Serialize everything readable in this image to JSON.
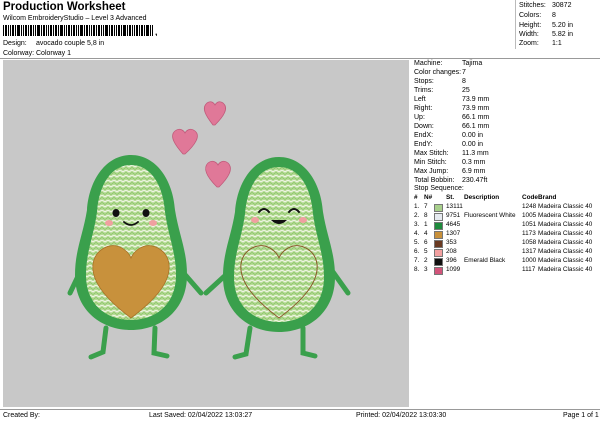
{
  "header": {
    "title": "Production Worksheet",
    "subtitle": "Wilcom EmbroideryStudio – Level 3 Advanced",
    "barcode_char": ","
  },
  "meta": {
    "design_label": "Design:",
    "design_value": "avocado couple 5,8 in",
    "colorway_label": "Colorway:",
    "colorway_value": "Colorway 1"
  },
  "stats": [
    {
      "label": "Stitches:",
      "value": "30872"
    },
    {
      "label": "Colors:",
      "value": "8"
    },
    {
      "label": "Height:",
      "value": "5.20 in"
    },
    {
      "label": "Width:",
      "value": "5.82 in"
    },
    {
      "label": "Zoom:",
      "value": "1:1"
    }
  ],
  "properties": [
    {
      "label": "Machine:",
      "value": "Tajima"
    },
    {
      "label": "Color changes:",
      "value": "7"
    },
    {
      "label": "Stops:",
      "value": "8"
    },
    {
      "label": "Trims:",
      "value": "25"
    },
    {
      "label": "Left",
      "value": "73.9 mm"
    },
    {
      "label": "Right:",
      "value": "73.9 mm"
    },
    {
      "label": "Up:",
      "value": "66.1 mm"
    },
    {
      "label": "Down:",
      "value": "66.1 mm"
    },
    {
      "label": "EndX:",
      "value": "0.00 in"
    },
    {
      "label": "EndY:",
      "value": "0.00 in"
    },
    {
      "label": "Max Stitch:",
      "value": "11.3 mm"
    },
    {
      "label": "Min Stitch:",
      "value": "0.3 mm"
    },
    {
      "label": "Max Jump:",
      "value": "6.9 mm"
    },
    {
      "label": "Total Bobbin:",
      "value": "230.47ft"
    }
  ],
  "stop_sequence": {
    "label": "Stop Sequence:",
    "headers": {
      "hash": "#",
      "n": "N#",
      "st": "St.",
      "desc": "Description",
      "code": "Code",
      "brand": "Brand"
    },
    "rows": [
      {
        "hash": "1.",
        "n": "7",
        "color": "#a8d08c",
        "st": "13111",
        "desc": "",
        "code": "1248",
        "brand": "Madeira Classic 40"
      },
      {
        "hash": "2.",
        "n": "8",
        "color": "#e6eaf0",
        "st": "9751",
        "desc": "Fluorescent White",
        "code": "1005",
        "brand": "Madeira Classic 40"
      },
      {
        "hash": "3.",
        "n": "1",
        "color": "#1e8a3c",
        "st": "4645",
        "desc": "",
        "code": "1051",
        "brand": "Madeira Classic 40"
      },
      {
        "hash": "4.",
        "n": "4",
        "color": "#c8903a",
        "st": "1307",
        "desc": "",
        "code": "1173",
        "brand": "Madeira Classic 40"
      },
      {
        "hash": "5.",
        "n": "6",
        "color": "#6a3a22",
        "st": "353",
        "desc": "",
        "code": "1058",
        "brand": "Madeira Classic 40"
      },
      {
        "hash": "6.",
        "n": "5",
        "color": "#f2a0a0",
        "st": "208",
        "desc": "",
        "code": "1317",
        "brand": "Madeira Classic 40"
      },
      {
        "hash": "7.",
        "n": "2",
        "color": "#101010",
        "st": "396",
        "desc": "Emerald Black",
        "code": "1000",
        "brand": "Madeira Classic 40"
      },
      {
        "hash": "8.",
        "n": "3",
        "color": "#d2547a",
        "st": "1099",
        "desc": "",
        "code": "1117",
        "brand": "Madeira Classic 40"
      }
    ]
  },
  "footer": {
    "created": "Created By:",
    "saved": "Last Saved: 02/04/2022 13:03:27",
    "printed": "Printed: 02/04/2022 13:03:30",
    "page": "Page 1 of 1"
  },
  "colors": {
    "design_bg": "#c8c8c8",
    "avocado_outer": "#3aa04c",
    "avocado_fill": "#b8db98",
    "pit": "#c8913c",
    "heart": "#e07898",
    "cheek": "#f0a0a0"
  }
}
